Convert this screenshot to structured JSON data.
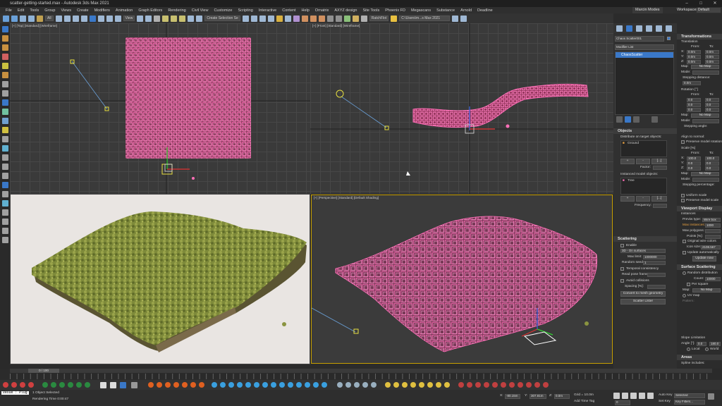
{
  "window": {
    "title": "scatter-getting-started.max - Autodesk 3ds Max 2021"
  },
  "menu": [
    "File",
    "Edit",
    "Tools",
    "Group",
    "Views",
    "Create",
    "Modifiers",
    "Animation",
    "Graph Editors",
    "Rendering",
    "Civil View",
    "Customize",
    "Scripting",
    "Interactive",
    "Content",
    "Help",
    "Ornatrix",
    "AXYZ design",
    "Site Tools",
    "Phoenix FD",
    "Megascans",
    "Substance",
    "Arnold",
    "Deadline"
  ],
  "user": "Marcin Modes",
  "workspace_label": "Workspaces:",
  "workspace_value": "Default",
  "toolbar": {
    "view_select": "View",
    "selection_set": "Create Selection Se",
    "path": "C:\\Users\\m...s Max 2021",
    "batch": "RatchFlot"
  },
  "viewports": {
    "top": "[+] [Top] [Standard] [Wireframe]",
    "front": "[+] [Front] [Standard] [Wireframe]",
    "perspective": "[+] [Perspective] [Standard] [Default Shading]"
  },
  "command_panel": {
    "object_name": "Chaos Scatter001",
    "modifier_list": "Modifier List",
    "stack_item": "ChaosScatter",
    "objects": {
      "title": "Objects",
      "distribute_label": "Distribute on target objects:",
      "target": "Ground",
      "factor_label": "Factor:",
      "instanced_label": "Instanced model objects:",
      "model": "Tree",
      "frequency_label": "Frequency:"
    },
    "scattering": {
      "title": "Scattering",
      "enable": "Enable",
      "mode": "3D - On surfaces",
      "max_limit_label": "Max limit:",
      "max_limit": "1000000",
      "random_seed_label": "Random seed:",
      "random_seed": "1",
      "temporal": "Temporal consistency",
      "read_pose": "Read pose frame:",
      "avoid": "Avoid collisions",
      "spacing_label": "Spacing [%]:",
      "convert_btn": "Convert to mesh geometry",
      "lister_btn": "Scatter Lister"
    }
  },
  "right_panel": {
    "transformations": "Transformations",
    "translation": "Translation",
    "from_label": "From:",
    "to_label": "To:",
    "xyz_rows": [
      {
        "axis": "X:",
        "from": "0.0m",
        "to": "0.0m"
      },
      {
        "axis": "Y:",
        "from": "0.0m",
        "to": "0.0m"
      },
      {
        "axis": "Z:",
        "from": "0.0m",
        "to": "0.0m"
      }
    ],
    "map_label": "Map:",
    "no_map": "No Map",
    "mode_label": "Mode:",
    "stepping_distance": "Stepping distance:",
    "rotation": "Rotation [°]",
    "stepping_angle": "Stepping angle:",
    "align_normal": "Align to normal:",
    "preserve_rotation": "Preserve model rotation",
    "scale": "Scale [%]",
    "scale_rows": [
      {
        "axis": "X:",
        "from": "100.0",
        "to": "100.0"
      },
      {
        "axis": "Y:",
        "from": "0.0",
        "to": "0.0"
      },
      {
        "axis": "Z:",
        "from": "0.0",
        "to": "0.0"
      }
    ],
    "stepping_percentage": "Stepping percentage:",
    "uniform_scale": "Uniform scale",
    "preserve_scale": "Preserve model scale",
    "viewport_display": "Viewport Display",
    "instances": "Instances",
    "preview_type_label": "Previw type:",
    "preview_type": "Wire box",
    "max_instances_label": "Max instances:",
    "max_instances": "1000",
    "max_polygons_label": "Max polygons:",
    "points_label": "Points [%]:",
    "original_colors": "Original wire colors",
    "icon_size_label": "Icon size:",
    "icon_size": "2108.567",
    "update_auto": "Update automatically",
    "update_now": "Update now",
    "surface_scattering": "Surface Scattering",
    "random_distribution": "Random distribution",
    "count_label": "Count:",
    "count": "10000",
    "per_square": "Per square",
    "uv_map": "UV map",
    "pattern_label": "Pattern:",
    "slope_limitation": "Slope Limitation",
    "angle_label": "Angle [°]:",
    "angle_from": "0.0",
    "angle_to": "180.0",
    "local": "Local",
    "world": "World",
    "areas": "Areas",
    "spline_includes": "Spline includes:"
  },
  "timeline": {
    "frame": "0 / 100"
  },
  "status": {
    "script_label": "Vesue : Plug",
    "selected": "1 Object Selected",
    "render_time": "Rendering Time 0:00:47",
    "x_label": "X:",
    "x": "-80.15m",
    "y_label": "Y:",
    "y": "307.81m",
    "z_label": "Z:",
    "z": "0.0m",
    "grid": "Grid = 10.0m",
    "add_time_tag": "Add Time Tag",
    "auto_key": "Auto Key",
    "set_key": "Set Key",
    "selected_dd": "Selected",
    "key_filters": "Key Filters...",
    "frame_value": "0"
  },
  "colors": {
    "pink": "#ff6fb8",
    "grass": "#7e8a3a",
    "selected_border": "#c8a000",
    "accent": "#2f6fb3"
  }
}
